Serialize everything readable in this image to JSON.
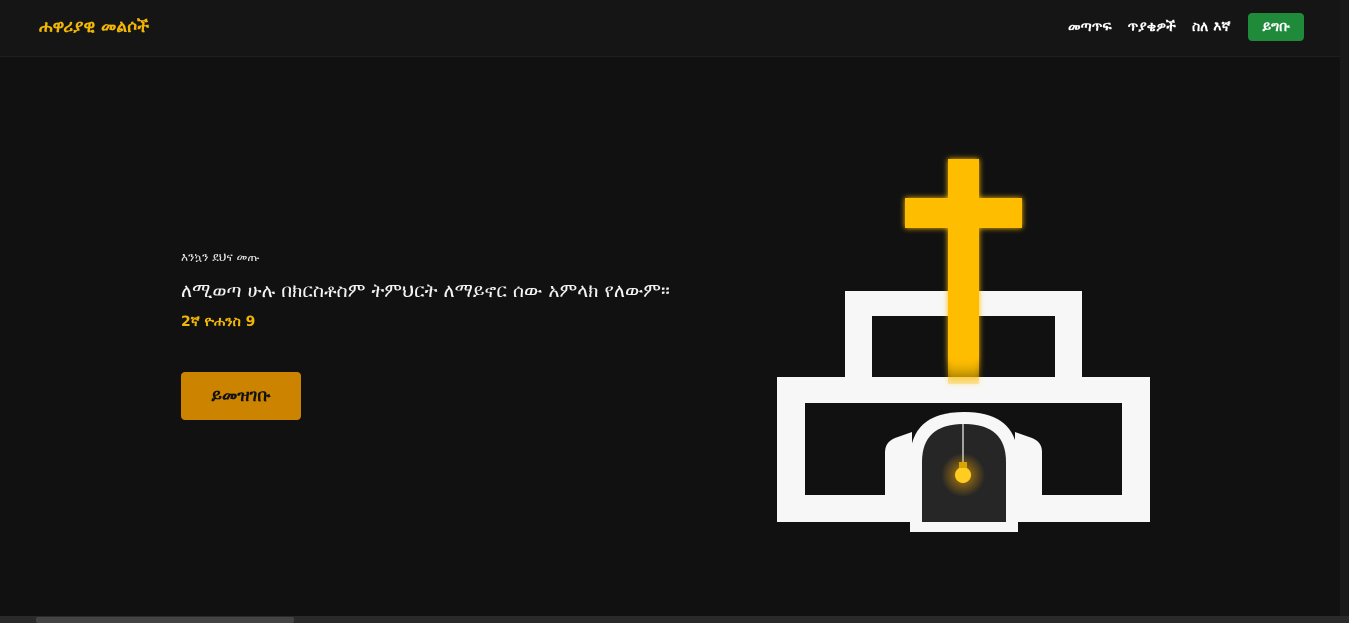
{
  "navbar": {
    "brand": "ሐዋሪያዊ መልሶች",
    "links": [
      "መጣጥፍ",
      "ጥያቄዎች",
      "ስለ እኛ"
    ],
    "login_label": "ይግቡ"
  },
  "hero": {
    "greeting": "እንኳን ደህና መጡ",
    "verse": "ለሚወጣ ሁሉ በክርስቶስም ትምህርት ለማይኖር ሰው አምላክ የለውም።",
    "reference": "2ኛ ዮሐንስ 9",
    "register_label": "ይመዝገቡ"
  },
  "colors": {
    "accent": "#f2b705",
    "register_button": "#cc8400",
    "login_button": "#1e8a3a",
    "background": "#111111"
  },
  "illustration": {
    "icon": "church-with-cross-icon"
  }
}
